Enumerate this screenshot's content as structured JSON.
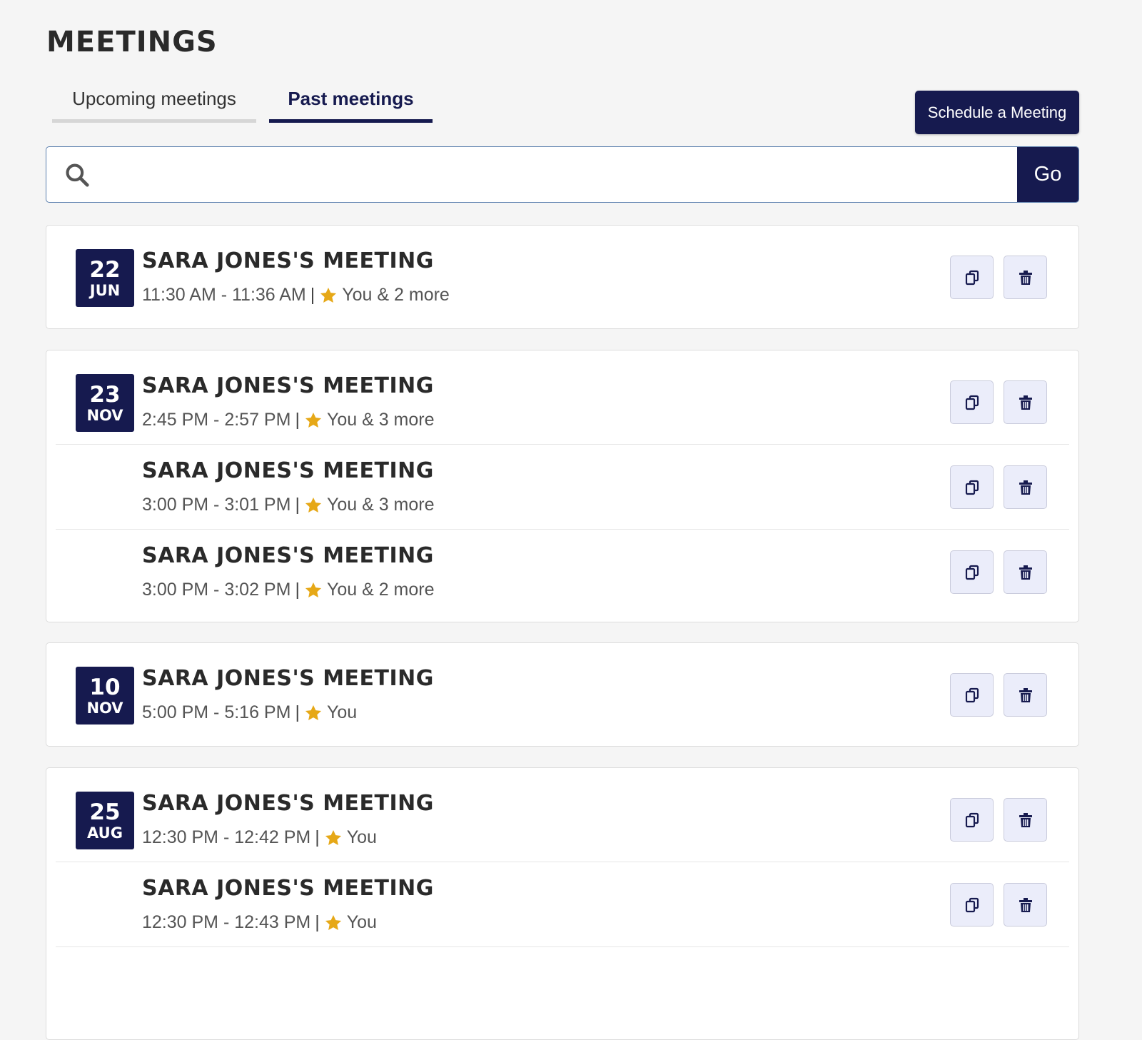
{
  "page": {
    "title": "MEETINGS"
  },
  "tabs": {
    "upcoming": "Upcoming meetings",
    "past": "Past meetings"
  },
  "schedule_button": "Schedule a Meeting",
  "search": {
    "value": "",
    "placeholder": "",
    "go_label": "Go"
  },
  "groups": [
    {
      "day": "22",
      "month": "JUN",
      "meetings": [
        {
          "title": "SARA JONES'S MEETING",
          "time": "11:30 AM - 11:36 AM",
          "participants": "You & 2 more"
        }
      ]
    },
    {
      "day": "23",
      "month": "NOV",
      "meetings": [
        {
          "title": "SARA JONES'S MEETING",
          "time": "2:45 PM - 2:57 PM",
          "participants": "You & 3 more"
        },
        {
          "title": "SARA JONES'S MEETING",
          "time": "3:00 PM - 3:01 PM",
          "participants": "You & 3 more"
        },
        {
          "title": "SARA JONES'S MEETING",
          "time": "3:00 PM - 3:02 PM",
          "participants": "You & 2 more"
        }
      ]
    },
    {
      "day": "10",
      "month": "NOV",
      "meetings": [
        {
          "title": "SARA JONES'S MEETING",
          "time": "5:00 PM - 5:16 PM",
          "participants": "You"
        }
      ]
    },
    {
      "day": "25",
      "month": "AUG",
      "meetings": [
        {
          "title": "SARA JONES'S MEETING",
          "time": "12:30 PM - 12:42 PM",
          "participants": "You"
        },
        {
          "title": "SARA JONES'S MEETING",
          "time": "12:30 PM - 12:43 PM",
          "participants": "You"
        },
        {
          "title": "",
          "time": "",
          "participants": ""
        }
      ]
    }
  ],
  "colors": {
    "primary": "#161a4f",
    "star": "#e6a817",
    "action_bg": "#ebedfa"
  },
  "icons": {
    "copy": "copy-icon",
    "delete": "trash-icon",
    "star": "star-icon",
    "search": "search-icon",
    "clear": "close-icon"
  }
}
